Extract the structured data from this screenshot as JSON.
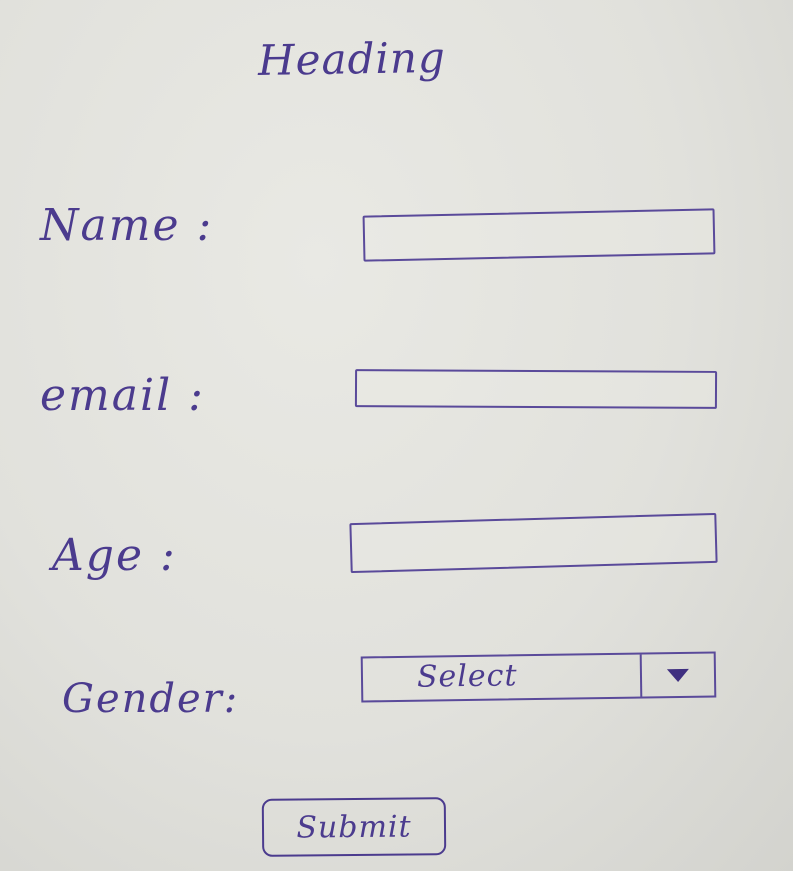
{
  "form": {
    "heading": "Heading",
    "fields": [
      {
        "label": "Name :",
        "value": ""
      },
      {
        "label": "email :",
        "value": ""
      },
      {
        "label": "Age :",
        "value": ""
      }
    ],
    "gender": {
      "label": "Gender:",
      "selected": "Select"
    },
    "submit_label": "Submit"
  },
  "colors": {
    "ink": "#4b3b8e",
    "paper": "#e1e1dc"
  },
  "icons": {
    "select_arrow": "triangle-down-icon"
  }
}
